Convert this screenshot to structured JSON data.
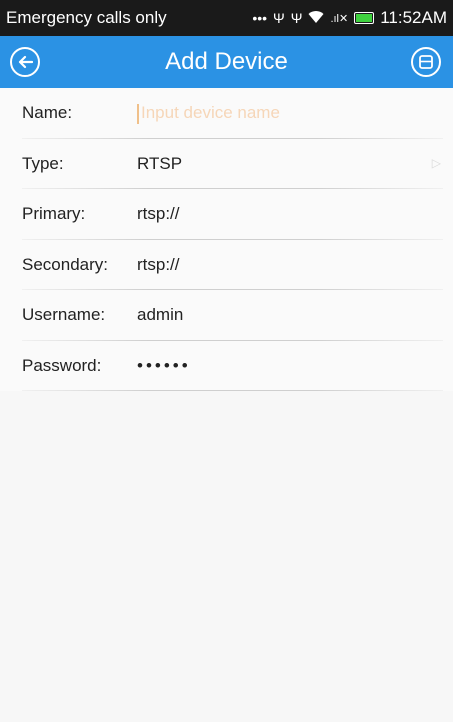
{
  "status_bar": {
    "carrier": "Emergency calls only",
    "time": "11:52AM"
  },
  "app_bar": {
    "title": "Add Device"
  },
  "form": {
    "name": {
      "label": "Name:",
      "placeholder": "Input device name",
      "value": ""
    },
    "type": {
      "label": "Type:",
      "value": "RTSP"
    },
    "primary": {
      "label": "Primary:",
      "value": "rtsp://"
    },
    "secondary": {
      "label": "Secondary:",
      "value": "rtsp://"
    },
    "username": {
      "label": "Username:",
      "value": "admin"
    },
    "password": {
      "label": "Password:",
      "value": "••••••"
    }
  },
  "colors": {
    "accent": "#2b92e4",
    "status_bar": "#1a1a1a",
    "placeholder": "#f6d6b8"
  }
}
